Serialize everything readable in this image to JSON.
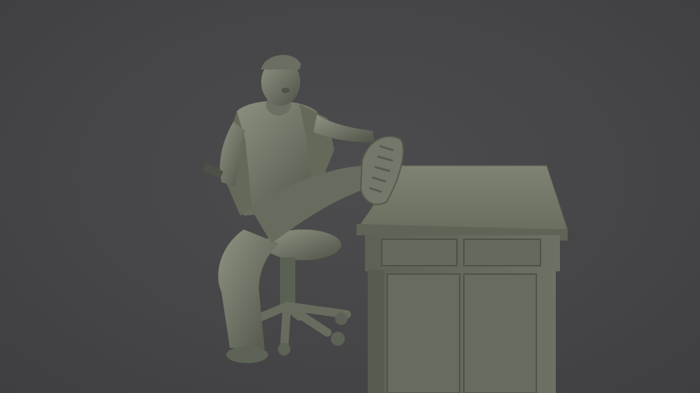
{
  "scene": {
    "subject": "sculpt-render",
    "background_color": "#464648",
    "material_color": "#6f7466",
    "material_shadow": "#4a4e44",
    "material_highlight": "#9a9f8e"
  }
}
